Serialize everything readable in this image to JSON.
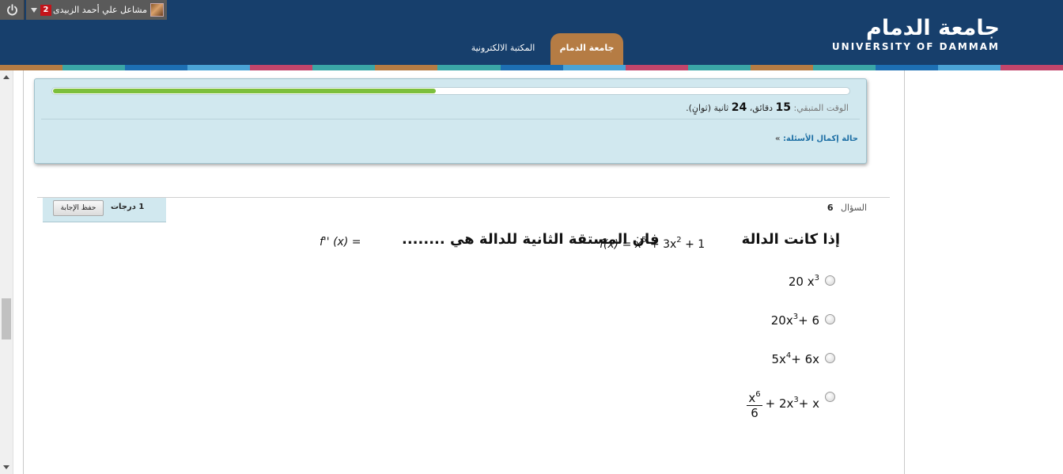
{
  "userbar": {
    "user_name": "مشاعل علي أحمد الزبيدى",
    "notification_count": "2"
  },
  "logo": {
    "arabic": "جامعة الدمام",
    "english": "UNIVERSITY OF DAMMAM"
  },
  "nav": {
    "tabs": [
      {
        "label": "جامعة الدمام",
        "active": true
      },
      {
        "label": "المكتبة الالكترونية",
        "active": false
      }
    ]
  },
  "colors": {
    "header": "#173f6c",
    "active_tab": "#b57c44",
    "panel": "#d1e8ef",
    "progress": "#7cbf3c"
  },
  "timer": {
    "label": "الوقت المتبقي:",
    "minutes": "15",
    "minutes_unit": "دقائق،",
    "seconds": "24",
    "seconds_unit": "ثانية (ثوانٍ).",
    "progress_fraction": 0.48
  },
  "status": {
    "label": "حالة إكمال الأسئلة:"
  },
  "question": {
    "label": "السؤال",
    "number": "6",
    "points_value": "1",
    "points_unit": "درجات",
    "save_label": "حفظ الإجابة",
    "stem_part1": "إذا كانت الدالة",
    "stem_part2": "فان المستقة الثانية للدالة  هي ........",
    "function": {
      "f": "f(x) = x",
      "e1": "5",
      "mid": "+ 3x",
      "e2": "2",
      "end": "+ 1"
    },
    "asked": {
      "f": "f'' (x) ="
    }
  },
  "options": [
    {
      "base": "20 x",
      "exp": "3",
      "tail": ""
    },
    {
      "base": "20x",
      "exp": "3",
      "tail": "+ 6"
    },
    {
      "base": "5x",
      "exp": "4",
      "tail": "+ 6x"
    },
    {
      "num": "x",
      "num_exp": "6",
      "den": "6",
      "mid": "+ 2x",
      "exp": "3",
      "tail": "+ x"
    }
  ]
}
